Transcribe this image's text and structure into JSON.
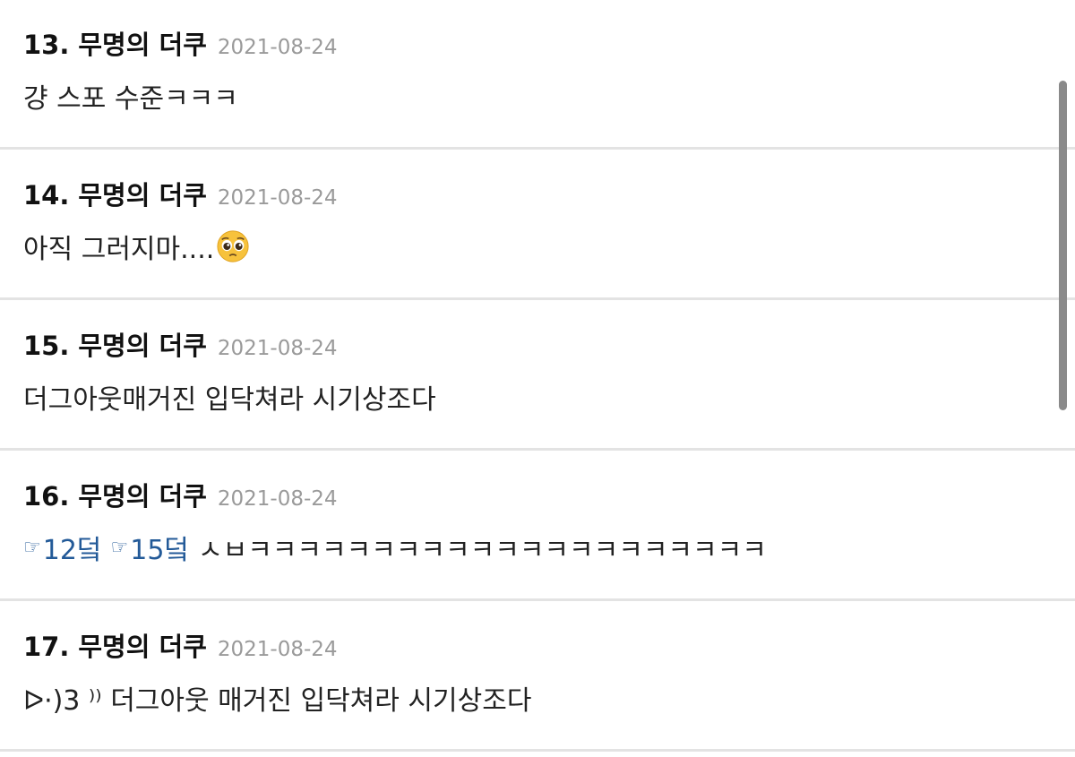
{
  "comments": [
    {
      "number": "13.",
      "author": "무명의 더쿠",
      "date": "2021-08-24",
      "text": "걍 스포 수준ㅋㅋㅋ"
    },
    {
      "number": "14.",
      "author": "무명의 더쿠",
      "date": "2021-08-24",
      "text": "아직 그러지마....",
      "emoji": "pleading-face-emoji"
    },
    {
      "number": "15.",
      "author": "무명의 더쿠",
      "date": "2021-08-24",
      "text": "더그아웃매거진 입닥쳐라 시기상조다"
    },
    {
      "number": "16.",
      "author": "무명의 더쿠",
      "date": "2021-08-24",
      "anchors": [
        {
          "icon": "pointing-hand-icon",
          "label": "12덬"
        },
        {
          "icon": "pointing-hand-icon",
          "label": "15덬"
        }
      ],
      "text": "ㅅㅂㅋㅋㅋㅋㅋㅋㅋㅋㅋㅋㅋㅋㅋㅋㅋㅋㅋㅋㅋㅋㅋ"
    },
    {
      "number": "17.",
      "author": "무명의 더쿠",
      "date": "2021-08-24",
      "text": "ᐅ·)3 ⁾⁾ 더그아웃 매거진 입닥쳐라 시기상조다"
    }
  ],
  "colors": {
    "anchor_link": "#235a98",
    "date_gray": "#9a9a9a",
    "divider": "#e3e3e3",
    "scrollbar": "#8a8a8a"
  }
}
